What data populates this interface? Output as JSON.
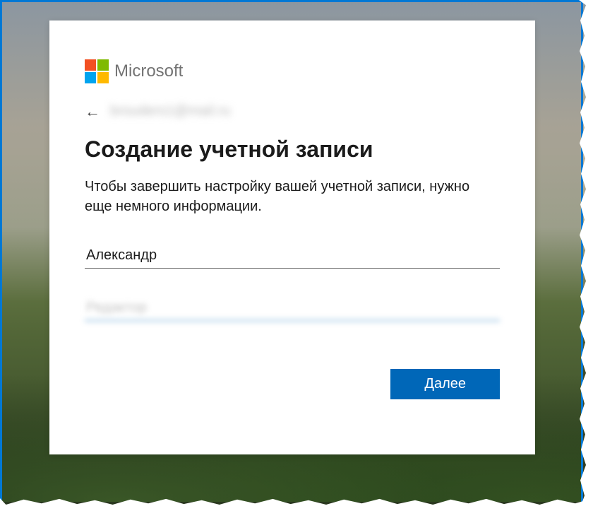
{
  "brand": {
    "name": "Microsoft"
  },
  "back": {
    "email_masked": "brouders1@mail.ru"
  },
  "heading": "Создание учетной записи",
  "description": "Чтобы завершить настройку вашей учетной записи, нужно еще немного информации.",
  "form": {
    "first_name_value": "Александр",
    "last_name_value": "Редактор"
  },
  "actions": {
    "next_label": "Далее"
  }
}
